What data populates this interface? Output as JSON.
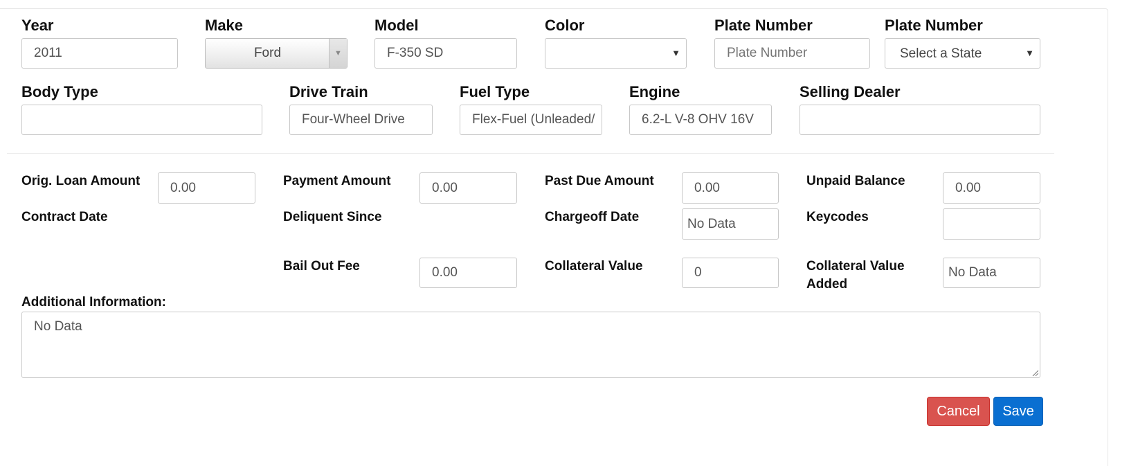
{
  "vehicle": {
    "year": {
      "label": "Year",
      "value": "2011"
    },
    "make": {
      "label": "Make",
      "value": "Ford"
    },
    "model": {
      "label": "Model",
      "value": "F-350 SD"
    },
    "color": {
      "label": "Color",
      "value": ""
    },
    "plate_number": {
      "label": "Plate Number",
      "placeholder": "Plate Number"
    },
    "plate_state": {
      "label": "Plate Number",
      "value": "Select a State"
    },
    "body_type": {
      "label": "Body Type",
      "value": ""
    },
    "drive_train": {
      "label": "Drive Train",
      "value": "Four-Wheel Drive"
    },
    "fuel_type": {
      "label": "Fuel Type",
      "value": "Flex-Fuel (Unleaded/"
    },
    "engine": {
      "label": "Engine",
      "value": "6.2-L V-8 OHV 16V"
    },
    "selling_dealer": {
      "label": "Selling Dealer",
      "value": ""
    }
  },
  "loan": {
    "orig_loan_amount": {
      "label": "Orig. Loan Amount",
      "value": "0.00"
    },
    "payment_amount": {
      "label": "Payment Amount",
      "value": "0.00"
    },
    "past_due_amount": {
      "label": "Past Due Amount",
      "value": "0.00"
    },
    "unpaid_balance": {
      "label": "Unpaid Balance",
      "value": "0.00"
    },
    "contract_date": {
      "label": "Contract Date"
    },
    "deliquent_since": {
      "label": "Deliquent Since"
    },
    "chargeoff_date": {
      "label": "Chargeoff Date",
      "value": "No Data"
    },
    "keycodes": {
      "label": "Keycodes",
      "value": ""
    },
    "bail_out_fee": {
      "label": "Bail Out Fee",
      "value": "0.00"
    },
    "collateral_value": {
      "label": "Collateral Value",
      "value": "0"
    },
    "collateral_value_added": {
      "label_line1": "Collateral Value",
      "label_line2": "Added",
      "value": "No Data"
    }
  },
  "additional": {
    "label": "Additional Information:",
    "value": "No Data"
  },
  "actions": {
    "cancel_label": "Cancel",
    "save_label": "Save"
  },
  "colors": {
    "cancel": "#d9534f",
    "save": "#0a6fd1",
    "border": "#c8c8c8"
  },
  "icons": {
    "select_caret": "caret-down-icon",
    "resize": "resize-grip-icon"
  }
}
